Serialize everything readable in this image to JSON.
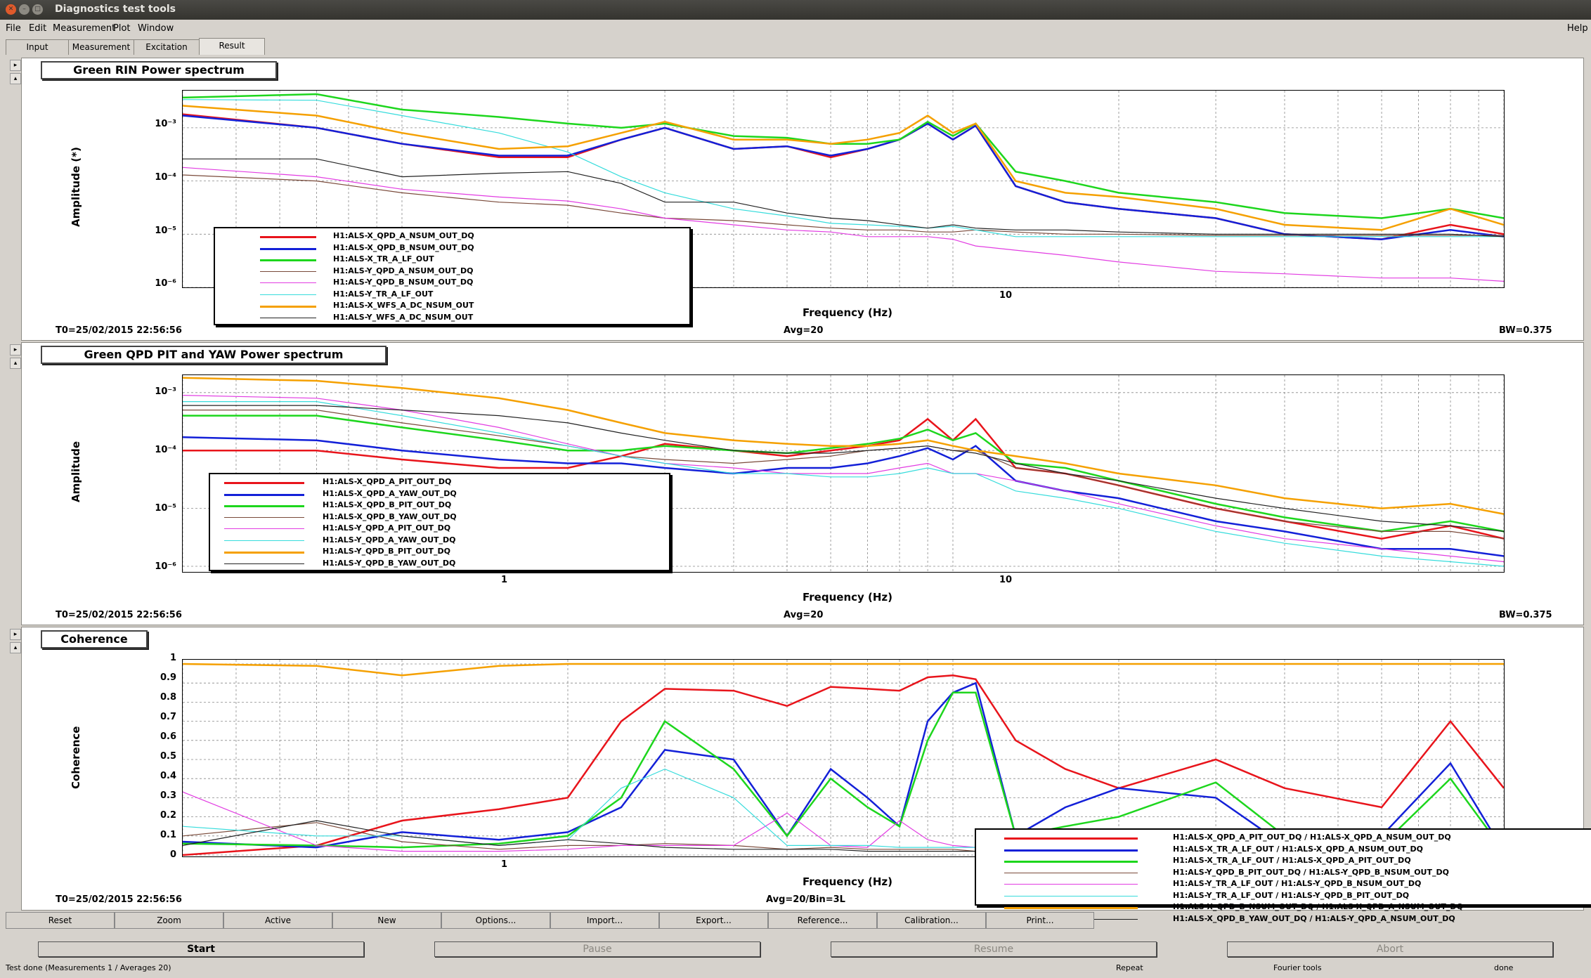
{
  "window": {
    "title": "Diagnostics test tools"
  },
  "menu": [
    "File",
    "Edit",
    "Measurement",
    "Plot",
    "Window"
  ],
  "menu_help": "Help",
  "tabs": [
    "Input",
    "Measurement",
    "Excitation",
    "Result"
  ],
  "active_tab": "Result",
  "panels": [
    {
      "title": "Green RIN Power spectrum",
      "ylabel": "Amplitude (*)",
      "xlabel": "Frequency (Hz)",
      "yticks": [
        "10⁻³",
        "10⁻⁴",
        "10⁻⁵",
        "10⁻⁶"
      ],
      "xticks": [
        "10"
      ],
      "t0": "T0=25/02/2015 22:56:56",
      "avg": "Avg=20",
      "bw": "BW=0.375",
      "legend": [
        {
          "name": "H1:ALS-X_QPD_A_NSUM_OUT_DQ",
          "color": "#e8141b"
        },
        {
          "name": "H1:ALS-X_QPD_B_NSUM_OUT_DQ",
          "color": "#1320d8"
        },
        {
          "name": "H1:ALS-X_TR_A_LF_OUT",
          "color": "#1dd61d"
        },
        {
          "name": "H1:ALS-Y_QPD_A_NSUM_OUT_DQ",
          "color": "#7a4a3a"
        },
        {
          "name": "H1:ALS-Y_QPD_B_NSUM_OUT_DQ",
          "color": "#e23ce2"
        },
        {
          "name": "H1:ALS-Y_TR_A_LF_OUT",
          "color": "#36dcdc"
        },
        {
          "name": "H1:ALS-X_WFS_A_DC_NSUM_OUT",
          "color": "#f5a000"
        },
        {
          "name": "H1:ALS-Y_WFS_A_DC_NSUM_OUT",
          "color": "#222222"
        }
      ]
    },
    {
      "title": "Green QPD PIT and YAW Power spectrum",
      "ylabel": "Amplitude",
      "xlabel": "Frequency (Hz)",
      "yticks": [
        "10⁻³",
        "10⁻⁴",
        "10⁻⁵",
        "10⁻⁶"
      ],
      "xticks": [
        "1",
        "10"
      ],
      "t0": "T0=25/02/2015 22:56:56",
      "avg": "Avg=20",
      "bw": "BW=0.375",
      "legend": [
        {
          "name": "H1:ALS-X_QPD_A_PIT_OUT_DQ",
          "color": "#e8141b"
        },
        {
          "name": "H1:ALS-X_QPD_A_YAW_OUT_DQ",
          "color": "#1320d8"
        },
        {
          "name": "H1:ALS-X_QPD_B_PIT_OUT_DQ",
          "color": "#1dd61d"
        },
        {
          "name": "H1:ALS-X_QPD_B_YAW_OUT_DQ",
          "color": "#7a4a3a"
        },
        {
          "name": "H1:ALS-Y_QPD_A_PIT_OUT_DQ",
          "color": "#e23ce2"
        },
        {
          "name": "H1:ALS-Y_QPD_A_YAW_OUT_DQ",
          "color": "#36dcdc"
        },
        {
          "name": "H1:ALS-Y_QPD_B_PIT_OUT_DQ",
          "color": "#f5a000"
        },
        {
          "name": "H1:ALS-Y_QPD_B_YAW_OUT_DQ",
          "color": "#222222"
        }
      ]
    },
    {
      "title": "Coherence",
      "ylabel": "Coherence",
      "xlabel": "Frequency (Hz)",
      "yticks": [
        "1",
        "0.9",
        "0.8",
        "0.7",
        "0.6",
        "0.5",
        "0.4",
        "0.3",
        "0.2",
        "0.1",
        "0"
      ],
      "xticks": [
        "1"
      ],
      "t0": "T0=25/02/2015 22:56:56",
      "avg": "Avg=20/Bin=3L",
      "legend": [
        {
          "name": "H1:ALS-X_QPD_A_PIT_OUT_DQ / H1:ALS-X_QPD_A_NSUM_OUT_DQ",
          "color": "#e8141b"
        },
        {
          "name": "H1:ALS-X_TR_A_LF_OUT / H1:ALS-X_QPD_A_NSUM_OUT_DQ",
          "color": "#1320d8"
        },
        {
          "name": "H1:ALS-X_TR_A_LF_OUT / H1:ALS-X_QPD_A_PIT_OUT_DQ",
          "color": "#1dd61d"
        },
        {
          "name": "H1:ALS-Y_QPD_B_PIT_OUT_DQ / H1:ALS-Y_QPD_B_NSUM_OUT_DQ",
          "color": "#7a4a3a"
        },
        {
          "name": "H1:ALS-Y_TR_A_LF_OUT / H1:ALS-Y_QPD_B_NSUM_OUT_DQ",
          "color": "#e23ce2"
        },
        {
          "name": "H1:ALS-Y_TR_A_LF_OUT / H1:ALS-Y_QPD_B_PIT_OUT_DQ",
          "color": "#36dcdc"
        },
        {
          "name": "H1:ALS-X_QPD_B_NSUM_OUT_DQ / H1:ALS-X_QPD_A_NSUM_OUT_DQ",
          "color": "#f5a000"
        },
        {
          "name": "H1:ALS-X_QPD_B_YAW_OUT_DQ / H1:ALS-Y_QPD_A_NSUM_OUT_DQ",
          "color": "#222222"
        }
      ]
    }
  ],
  "bottom_buttons": [
    "Reset",
    "Zoom",
    "Active",
    "New",
    "Options...",
    "Import...",
    "Export...",
    "Reference...",
    "Calibration...",
    "Print..."
  ],
  "control_buttons": [
    "Start",
    "Pause",
    "Resume",
    "Abort"
  ],
  "status": {
    "left": "Test done (Measurements 1 / Averages 20)",
    "repeat": "Repeat",
    "tools": "Fourier tools",
    "state": "done"
  },
  "chart_data": [
    {
      "type": "line",
      "title": "Green RIN Power spectrum",
      "xlabel": "Frequency (Hz)",
      "ylabel": "Amplitude (*)",
      "yscale": "log",
      "xscale": "log",
      "xlim": [
        0.4,
        100
      ],
      "ylim": [
        1e-06,
        0.005
      ],
      "grid": true,
      "legend_position": "bottom-left",
      "x": [
        0.4,
        0.7,
        1.0,
        1.5,
        2.0,
        2.5,
        3.0,
        4.0,
        5.0,
        6.0,
        7.0,
        8.0,
        9.0,
        10.0,
        11.0,
        13.0,
        16.0,
        20.0,
        30.0,
        40.0,
        60.0,
        80.0,
        100.0
      ],
      "series": [
        {
          "name": "H1:ALS-X_QPD_A_NSUM_OUT_DQ",
          "values": [
            0.0018,
            0.001,
            0.0005,
            0.00028,
            0.00028,
            0.0006,
            0.001,
            0.0004,
            0.00045,
            0.00028,
            0.0004,
            0.0006,
            0.0012,
            0.0006,
            0.0011,
            8e-05,
            4e-05,
            3e-05,
            2e-05,
            1e-05,
            8e-06,
            1.5e-05,
            1e-05
          ]
        },
        {
          "name": "H1:ALS-X_QPD_B_NSUM_OUT_DQ",
          "values": [
            0.0017,
            0.001,
            0.0005,
            0.0003,
            0.0003,
            0.0006,
            0.001,
            0.0004,
            0.00045,
            0.0003,
            0.0004,
            0.0006,
            0.0012,
            0.0006,
            0.0011,
            8e-05,
            4e-05,
            3e-05,
            2e-05,
            1e-05,
            8e-06,
            1.2e-05,
            9e-06
          ]
        },
        {
          "name": "H1:ALS-X_TR_A_LF_OUT",
          "values": [
            0.0037,
            0.0043,
            0.0022,
            0.0016,
            0.0012,
            0.001,
            0.0012,
            0.0007,
            0.00065,
            0.0005,
            0.0005,
            0.0006,
            0.0013,
            0.0007,
            0.0012,
            0.00015,
            0.0001,
            6e-05,
            4e-05,
            2.5e-05,
            2e-05,
            3e-05,
            2e-05
          ]
        },
        {
          "name": "H1:ALS-Y_QPD_A_NSUM_OUT_DQ",
          "values": [
            0.00013,
            0.0001,
            6e-05,
            4e-05,
            3.5e-05,
            2.5e-05,
            2e-05,
            1.8e-05,
            1.5e-05,
            1.3e-05,
            1.2e-05,
            1.2e-05,
            1.1e-05,
            1.1e-05,
            1.2e-05,
            1.1e-05,
            1e-05,
            1e-05,
            9.5e-06,
            9.5e-06,
            9.5e-06,
            9.5e-06,
            9.5e-06
          ]
        },
        {
          "name": "H1:ALS-Y_QPD_B_NSUM_OUT_DQ",
          "values": [
            0.00018,
            0.00012,
            7e-05,
            5e-05,
            4.2e-05,
            3e-05,
            2e-05,
            1.5e-05,
            1.2e-05,
            1.1e-05,
            9e-06,
            9e-06,
            9e-06,
            8e-06,
            6e-06,
            5e-06,
            4e-06,
            3e-06,
            2e-06,
            1.8e-06,
            1.5e-06,
            1.5e-06,
            1.3e-06
          ]
        },
        {
          "name": "H1:ALS-Y_TR_A_LF_OUT",
          "values": [
            0.0034,
            0.0033,
            0.0017,
            0.0008,
            0.00035,
            0.00012,
            6e-05,
            3e-05,
            2.2e-05,
            1.6e-05,
            1.5e-05,
            1.4e-05,
            1.3e-05,
            1.4e-05,
            1.2e-05,
            9e-06,
            9e-06,
            9e-06,
            9e-06,
            9e-06,
            9e-06,
            9e-06,
            9e-06
          ]
        },
        {
          "name": "H1:ALS-X_WFS_A_DC_NSUM_OUT",
          "values": [
            0.0026,
            0.0017,
            0.0008,
            0.0004,
            0.00045,
            0.0008,
            0.0013,
            0.0006,
            0.0006,
            0.0005,
            0.0006,
            0.0008,
            0.0017,
            0.0008,
            0.0012,
            0.0001,
            6e-05,
            5e-05,
            3e-05,
            1.5e-05,
            1.2e-05,
            3e-05,
            1.5e-05
          ]
        },
        {
          "name": "H1:ALS-Y_WFS_A_DC_NSUM_OUT",
          "values": [
            0.00026,
            0.00026,
            0.00012,
            0.00014,
            0.00015,
            9e-05,
            4e-05,
            4e-05,
            2.5e-05,
            2e-05,
            1.8e-05,
            1.5e-05,
            1.3e-05,
            1.5e-05,
            1.3e-05,
            1.2e-05,
            1.2e-05,
            1.1e-05,
            1e-05,
            1e-05,
            1e-05,
            1e-05,
            9e-06
          ]
        }
      ]
    },
    {
      "type": "line",
      "title": "Green QPD PIT and YAW Power spectrum",
      "xlabel": "Frequency (Hz)",
      "ylabel": "Amplitude",
      "yscale": "log",
      "xscale": "log",
      "xlim": [
        0.4,
        100
      ],
      "ylim": [
        8e-07,
        0.002
      ],
      "grid": true,
      "legend_position": "bottom-left",
      "x": [
        0.4,
        0.7,
        1.0,
        1.5,
        2.0,
        2.5,
        3.0,
        4.0,
        5.0,
        6.0,
        7.0,
        8.0,
        9.0,
        10.0,
        11.0,
        13.0,
        16.0,
        20.0,
        30.0,
        40.0,
        60.0,
        80.0,
        100.0
      ],
      "series": [
        {
          "name": "H1:ALS-X_QPD_A_PIT_OUT_DQ",
          "values": [
            0.0001,
            0.0001,
            7e-05,
            5e-05,
            5e-05,
            8e-05,
            0.00013,
            0.0001,
            8e-05,
            0.0001,
            0.00012,
            0.00015,
            0.00035,
            0.00015,
            0.00035,
            5e-05,
            4e-05,
            2.5e-05,
            1e-05,
            6e-06,
            3e-06,
            5e-06,
            3e-06
          ]
        },
        {
          "name": "H1:ALS-X_QPD_A_YAW_OUT_DQ",
          "values": [
            0.00017,
            0.00015,
            0.0001,
            7e-05,
            6e-05,
            6e-05,
            5e-05,
            4e-05,
            5e-05,
            5e-05,
            6e-05,
            8e-05,
            0.00011,
            7e-05,
            0.00012,
            3e-05,
            2e-05,
            1.5e-05,
            6e-06,
            4e-06,
            2e-06,
            2e-06,
            1.5e-06
          ]
        },
        {
          "name": "H1:ALS-X_QPD_B_PIT_OUT_DQ",
          "values": [
            0.0004,
            0.0004,
            0.00025,
            0.00015,
            0.0001,
            0.0001,
            0.00012,
            0.0001,
            9e-05,
            0.00011,
            0.00013,
            0.00016,
            0.00023,
            0.00015,
            0.0002,
            6e-05,
            5e-05,
            3e-05,
            1.2e-05,
            7e-06,
            4e-06,
            6e-06,
            4e-06
          ]
        },
        {
          "name": "H1:ALS-X_QPD_B_YAW_OUT_DQ",
          "values": [
            0.0005,
            0.0005,
            0.0003,
            0.00018,
            0.00012,
            8e-05,
            7e-05,
            6e-05,
            7e-05,
            8e-05,
            0.0001,
            0.00011,
            0.00012,
            0.0001,
            0.0001,
            5e-05,
            4e-05,
            2.5e-05,
            1e-05,
            6e-06,
            4e-06,
            4e-06,
            3e-06
          ]
        },
        {
          "name": "H1:ALS-Y_QPD_A_PIT_OUT_DQ",
          "values": [
            0.0009,
            0.0008,
            0.0005,
            0.00025,
            0.00013,
            8e-05,
            6e-05,
            5e-05,
            4e-05,
            4e-05,
            4e-05,
            5e-05,
            6e-05,
            4e-05,
            4e-05,
            3e-05,
            2e-05,
            1.2e-05,
            5e-06,
            3e-06,
            2e-06,
            1.5e-06,
            1.2e-06
          ]
        },
        {
          "name": "H1:ALS-Y_QPD_A_YAW_OUT_DQ",
          "values": [
            0.0007,
            0.0007,
            0.0004,
            0.0002,
            0.00012,
            8e-05,
            6e-05,
            4e-05,
            4e-05,
            3.5e-05,
            3.5e-05,
            4e-05,
            5e-05,
            4e-05,
            4e-05,
            2e-05,
            1.5e-05,
            1e-05,
            4e-06,
            2.5e-06,
            1.5e-06,
            1.2e-06,
            1e-06
          ]
        },
        {
          "name": "H1:ALS-Y_QPD_B_PIT_OUT_DQ",
          "values": [
            0.0018,
            0.0016,
            0.0012,
            0.0008,
            0.0005,
            0.0003,
            0.0002,
            0.00015,
            0.00013,
            0.00012,
            0.00012,
            0.00013,
            0.00015,
            0.00012,
            0.0001,
            8e-05,
            6e-05,
            4e-05,
            2.5e-05,
            1.5e-05,
            1e-05,
            1.2e-05,
            8e-06
          ]
        },
        {
          "name": "H1:ALS-Y_QPD_B_YAW_OUT_DQ",
          "values": [
            0.0006,
            0.0006,
            0.0005,
            0.0004,
            0.0003,
            0.0002,
            0.00015,
            0.0001,
            9e-05,
            9e-05,
            0.0001,
            0.00011,
            0.00012,
            0.0001,
            9e-05,
            6e-05,
            4e-05,
            3e-05,
            1.5e-05,
            1e-05,
            6e-06,
            5e-06,
            4e-06
          ]
        }
      ]
    },
    {
      "type": "line",
      "title": "Coherence",
      "xlabel": "Frequency (Hz)",
      "ylabel": "Coherence",
      "xscale": "log",
      "xlim": [
        0.4,
        100
      ],
      "ylim": [
        0,
        1
      ],
      "grid": true,
      "legend_position": "bottom-right",
      "x": [
        0.4,
        0.7,
        1.0,
        1.5,
        2.0,
        2.5,
        3.0,
        4.0,
        5.0,
        6.0,
        7.0,
        8.0,
        9.0,
        10.0,
        11.0,
        13.0,
        16.0,
        20.0,
        30.0,
        40.0,
        60.0,
        80.0,
        100.0
      ],
      "series": [
        {
          "name": "H1:ALS-X_QPD_A_PIT_OUT_DQ / H1:ALS-X_QPD_A_NSUM_OUT_DQ",
          "values": [
            0.0,
            0.05,
            0.18,
            0.24,
            0.3,
            0.7,
            0.87,
            0.86,
            0.78,
            0.88,
            0.87,
            0.86,
            0.93,
            0.94,
            0.92,
            0.6,
            0.45,
            0.35,
            0.5,
            0.35,
            0.25,
            0.7,
            0.35
          ]
        },
        {
          "name": "H1:ALS-X_TR_A_LF_OUT / H1:ALS-X_QPD_A_NSUM_OUT_DQ",
          "values": [
            0.07,
            0.04,
            0.12,
            0.08,
            0.12,
            0.25,
            0.55,
            0.5,
            0.1,
            0.45,
            0.3,
            0.15,
            0.7,
            0.85,
            0.9,
            0.1,
            0.25,
            0.35,
            0.3,
            0.05,
            0.1,
            0.48,
            0.02
          ]
        },
        {
          "name": "H1:ALS-X_TR_A_LF_OUT / H1:ALS-X_QPD_A_PIT_OUT_DQ",
          "values": [
            0.06,
            0.05,
            0.04,
            0.06,
            0.1,
            0.3,
            0.7,
            0.45,
            0.1,
            0.4,
            0.25,
            0.15,
            0.6,
            0.85,
            0.85,
            0.1,
            0.15,
            0.2,
            0.38,
            0.1,
            0.05,
            0.4,
            0.02
          ]
        },
        {
          "name": "H1:ALS-Y_QPD_B_PIT_OUT_DQ / H1:ALS-Y_QPD_B_NSUM_OUT_DQ",
          "values": [
            0.1,
            0.17,
            0.07,
            0.03,
            0.05,
            0.05,
            0.06,
            0.05,
            0.03,
            0.04,
            0.03,
            0.03,
            0.03,
            0.03,
            0.02,
            0.02,
            0.02,
            0.02,
            0.02,
            0.02,
            0.02,
            0.02,
            0.02
          ]
        },
        {
          "name": "H1:ALS-Y_TR_A_LF_OUT / H1:ALS-Y_QPD_B_NSUM_OUT_DQ",
          "values": [
            0.33,
            0.05,
            0.02,
            0.02,
            0.03,
            0.05,
            0.05,
            0.05,
            0.22,
            0.05,
            0.04,
            0.18,
            0.08,
            0.05,
            0.04,
            0.03,
            0.03,
            0.03,
            0.03,
            0.03,
            0.03,
            0.03,
            0.03
          ]
        },
        {
          "name": "H1:ALS-Y_TR_A_LF_OUT / H1:ALS-Y_QPD_B_PIT_OUT_DQ",
          "values": [
            0.15,
            0.1,
            0.1,
            0.05,
            0.08,
            0.35,
            0.45,
            0.3,
            0.05,
            0.05,
            0.05,
            0.04,
            0.04,
            0.04,
            0.04,
            0.04,
            0.04,
            0.04,
            0.04,
            0.04,
            0.04,
            0.04,
            0.04
          ]
        },
        {
          "name": "H1:ALS-X_QPD_B_NSUM_OUT_DQ / H1:ALS-X_QPD_A_NSUM_OUT_DQ",
          "values": [
            1.0,
            0.99,
            0.94,
            0.99,
            1.0,
            1.0,
            1.0,
            1.0,
            1.0,
            1.0,
            1.0,
            1.0,
            1.0,
            1.0,
            1.0,
            1.0,
            1.0,
            1.0,
            1.0,
            1.0,
            1.0,
            1.0,
            1.0
          ]
        },
        {
          "name": "H1:ALS-X_QPD_B_YAW_OUT_DQ / H1:ALS-Y_QPD_A_NSUM_OUT_DQ",
          "values": [
            0.05,
            0.18,
            0.1,
            0.05,
            0.08,
            0.06,
            0.04,
            0.03,
            0.03,
            0.03,
            0.02,
            0.02,
            0.02,
            0.02,
            0.02,
            0.02,
            0.02,
            0.02,
            0.02,
            0.02,
            0.02,
            0.02,
            0.02
          ]
        }
      ]
    }
  ]
}
